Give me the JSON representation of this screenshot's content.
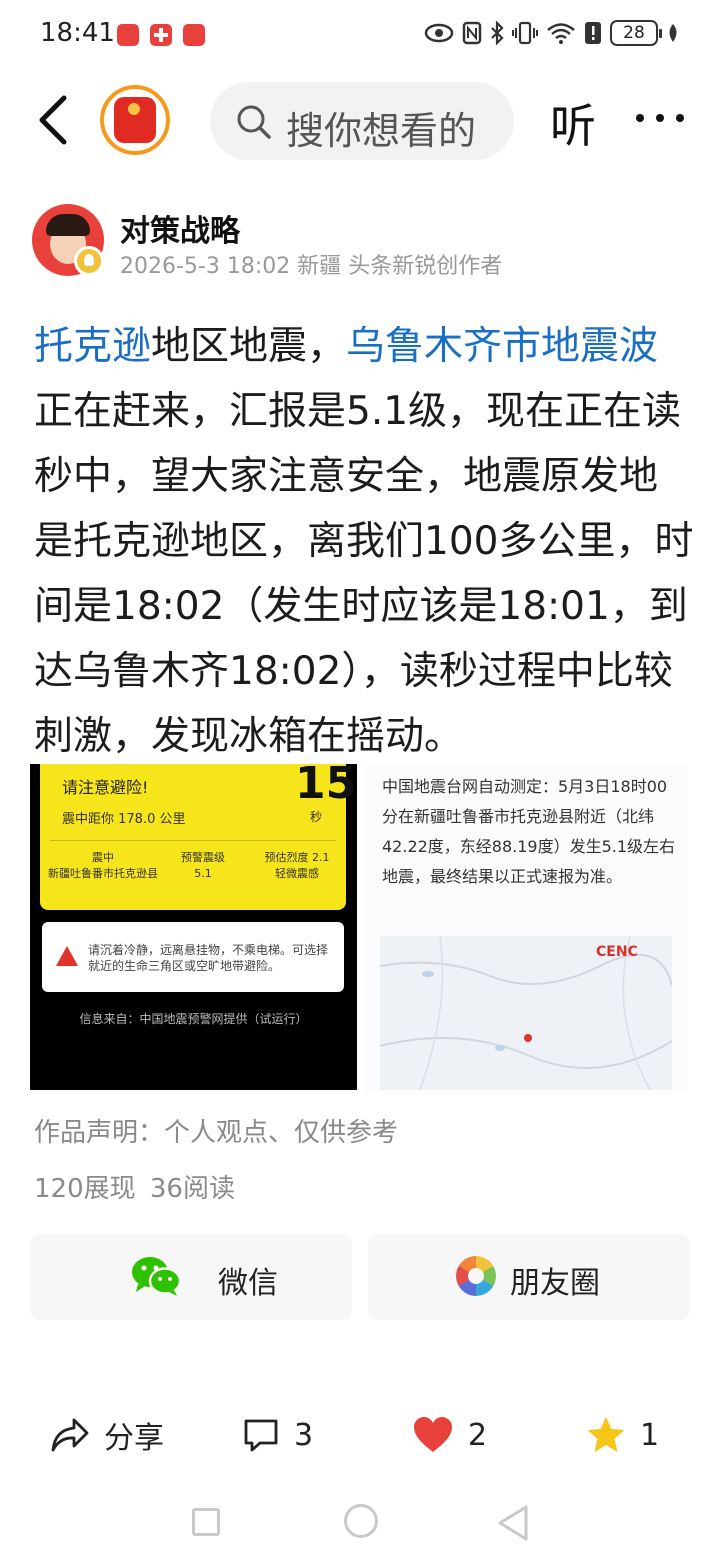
{
  "status_bar": {
    "time": "18:41",
    "battery": "28",
    "notification_icons": [
      "app-notification-icon",
      "app-notification-icon",
      "app-notification-icon"
    ],
    "system_icons": [
      "eye-icon",
      "nfc-icon",
      "bluetooth-icon",
      "vibrate-icon",
      "wifi-icon",
      "alert-icon",
      "battery-icon",
      "leaf-icon"
    ]
  },
  "top_nav": {
    "search_placeholder": "搜你想看的",
    "listen_label": "听"
  },
  "author": {
    "name": "对策战略",
    "meta": "2026-5-3 18:02 新疆 头条新锐创作者"
  },
  "article": {
    "link1": "托克逊",
    "text1": "地区地震，",
    "link2": "乌鲁木齐市地震波",
    "text2": "正在赶来，汇报是5.1级，现在正在读秒中，望大家注意安全，地震原发地是托克逊地区，离我们100多公里，时间是18:02（发生时应该是18:01，到达乌鲁木齐18:02），读秒过程中比较刺激，发现冰箱在摇动。"
  },
  "image_left": {
    "title": "请注意避险!",
    "countdown": "15",
    "distance": "震中距你 178.0 公里",
    "seconds_unit": "秒",
    "epicenter_label": "震中",
    "epicenter_value": "新疆吐鲁番市托克逊县",
    "magnitude_label": "预警震级",
    "magnitude_value": "5.1",
    "intensity_label": "预估烈度 2.1",
    "intensity_value": "轻微震感",
    "advice": "请沉着冷静，远离悬挂物，不乘电梯。可选择就近的生命三角区或空旷地带避险。",
    "source": "信息来自：中国地震预警网提供（试运行）"
  },
  "image_right": {
    "report": "中国地震台网自动测定：5月3日18时00分在新疆吐鲁番市托克逊县附近（北纬42.22度，东经88.19度）发生5.1级左右地震，最终结果以正式速报为准。",
    "map_logo": "CENC"
  },
  "declaration": "作品声明：个人观点、仅供参考",
  "stats": "120展现 36阅读",
  "share": {
    "wechat": "微信",
    "moments": "朋友圈"
  },
  "actions": {
    "share_label": "分享",
    "comments": "3",
    "likes": "2",
    "favorites": "1"
  },
  "colors": {
    "link": "#1a6fc4",
    "like": "#e8413b",
    "favorite": "#f5c518",
    "wechat": "#2dc100"
  }
}
